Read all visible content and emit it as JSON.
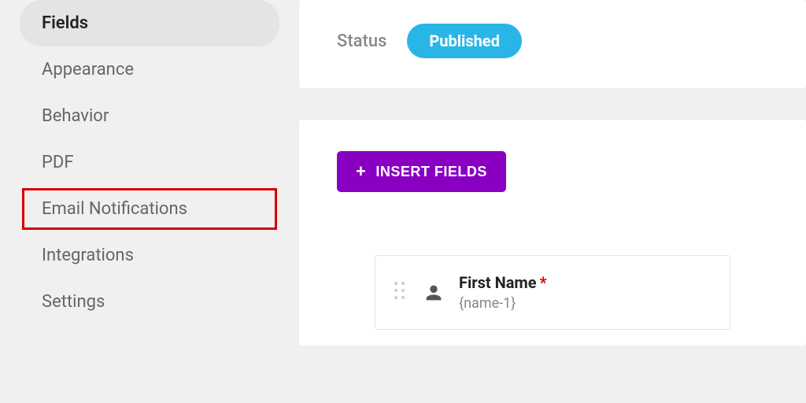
{
  "sidebar": {
    "items": [
      {
        "label": "Fields"
      },
      {
        "label": "Appearance"
      },
      {
        "label": "Behavior"
      },
      {
        "label": "PDF"
      },
      {
        "label": "Email Notifications"
      },
      {
        "label": "Integrations"
      },
      {
        "label": "Settings"
      }
    ]
  },
  "status": {
    "label": "Status",
    "value": "Published"
  },
  "insert_button": {
    "label": "INSERT FIELDS"
  },
  "field": {
    "label": "First Name",
    "required_mark": "*",
    "token": "{name-1}"
  }
}
